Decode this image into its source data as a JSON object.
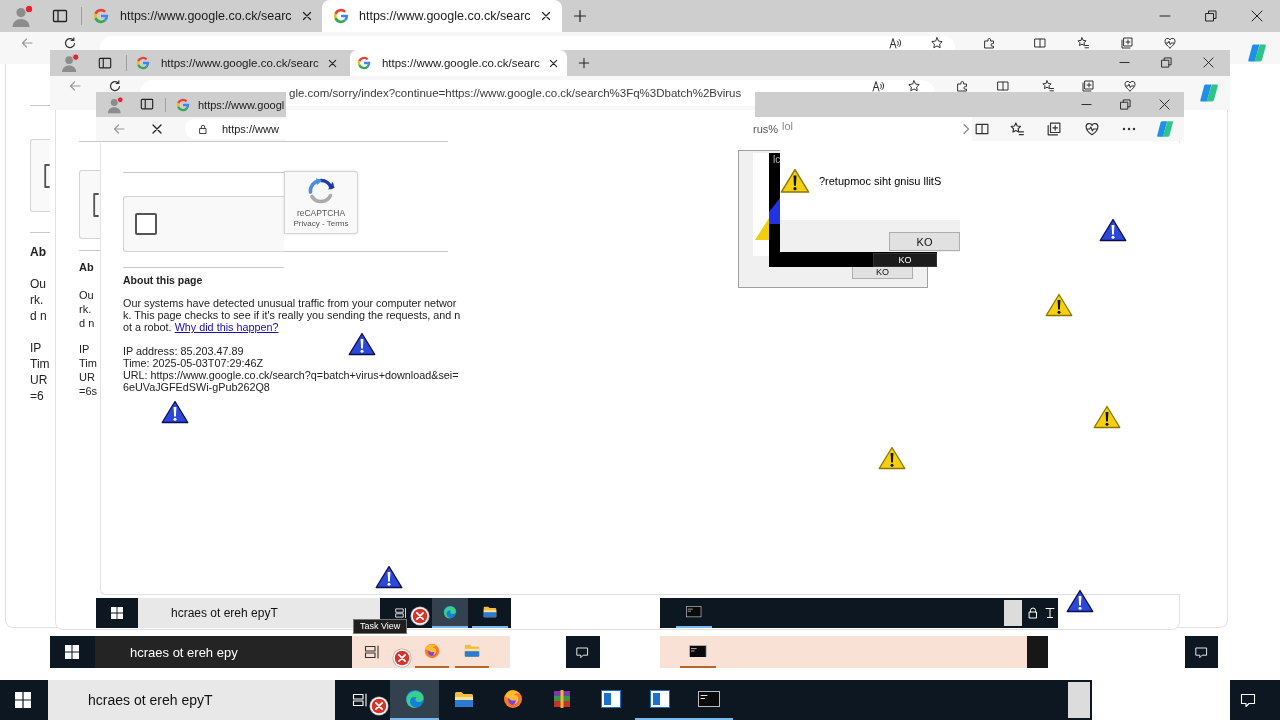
{
  "windows": [
    {
      "tabs": [
        {
          "title": "https://www.google.co.ck/searc",
          "selected": false
        },
        {
          "title": "https://www.google.co.ck/searc",
          "selected": true
        }
      ],
      "page": {
        "recaptcha": {
          "checked": false
        },
        "heading": "Ab",
        "paragraph_lines": [
          "Ou",
          "rk.",
          "d n"
        ],
        "detail_lines": [
          "IP",
          "Tim",
          "UR",
          "=6"
        ]
      }
    },
    {
      "tabs": [
        {
          "title": "https://www.google.co.ck/searc",
          "selected": false
        },
        {
          "title": "https://www.google.co.ck/searc",
          "selected": true
        }
      ],
      "address": "gle.com/sorry/index?continue=https://www.google.co.ck/search%3Fq%3Dbatch%2Bvirus",
      "page": {
        "recaptcha": {
          "checked": false
        },
        "heading": "Ab",
        "paragraph_lines": [
          "Ou",
          "rk.",
          "d n"
        ],
        "detail_lines": [
          "IP",
          "Tim",
          "UR",
          "=6s"
        ]
      },
      "taskbar": {
        "placeholder": "hcraes ot ereh epy",
        "apps": [
          {
            "kind": "firefox",
            "running": true,
            "active": false
          },
          {
            "kind": "explorer",
            "running": true,
            "active": false
          }
        ],
        "more_apps": [
          {
            "kind": "terminal",
            "running": true,
            "active": false
          }
        ]
      }
    },
    {
      "tabs": [
        {
          "title": "https://www.googl",
          "selected": false
        }
      ],
      "address": "https://www",
      "address_tail": "rus%",
      "page": {
        "recaptcha": {
          "checked": false,
          "brand": "reCAPTCHA",
          "links": "Privacy - Terms"
        },
        "heading": "About this page",
        "paragraph": "Our systems have detected unusual traffic from your computer network. This page checks to see if it's really you sending the requests, and not a robot.",
        "link": "Why did this happen?",
        "details": [
          "IP address: 85.203.47.89",
          "Time: 2025-05-03T07:29:46Z",
          "URL: https://www.google.co.ck/search?q=batch+virus+download&sei=6eUVaJGFEdSWi-gPub262Q8"
        ]
      },
      "taskbar": {
        "placeholder": "hcraes ot ereh epyT",
        "apps": [
          {
            "kind": "edge",
            "running": true,
            "active": true
          },
          {
            "kind": "explorer",
            "running": true,
            "active": false
          }
        ],
        "more_apps": [
          {
            "kind": "terminal",
            "running": true,
            "active": false
          }
        ]
      }
    }
  ],
  "dialogs": [
    {
      "kind": "message",
      "title": "lol",
      "message": "?retupmoc siht gnisu llitS",
      "button": "KO"
    },
    {
      "kind": "dark",
      "title": "lc",
      "button": "KO"
    },
    {
      "kind": "ghost",
      "button": "KO"
    }
  ],
  "tooltip": "Task View",
  "taskbar": {
    "placeholder": "hcraes ot ereh epyT",
    "apps": [
      {
        "kind": "edge",
        "running": true,
        "active": true
      },
      {
        "kind": "explorer",
        "running": false,
        "active": false
      },
      {
        "kind": "firefox",
        "running": false,
        "active": false
      },
      {
        "kind": "winrar",
        "running": false,
        "active": false
      },
      {
        "kind": "app",
        "running": false,
        "active": false
      },
      {
        "kind": "app",
        "running": true,
        "active": false
      },
      {
        "kind": "terminal",
        "running": true,
        "active": false
      }
    ]
  }
}
